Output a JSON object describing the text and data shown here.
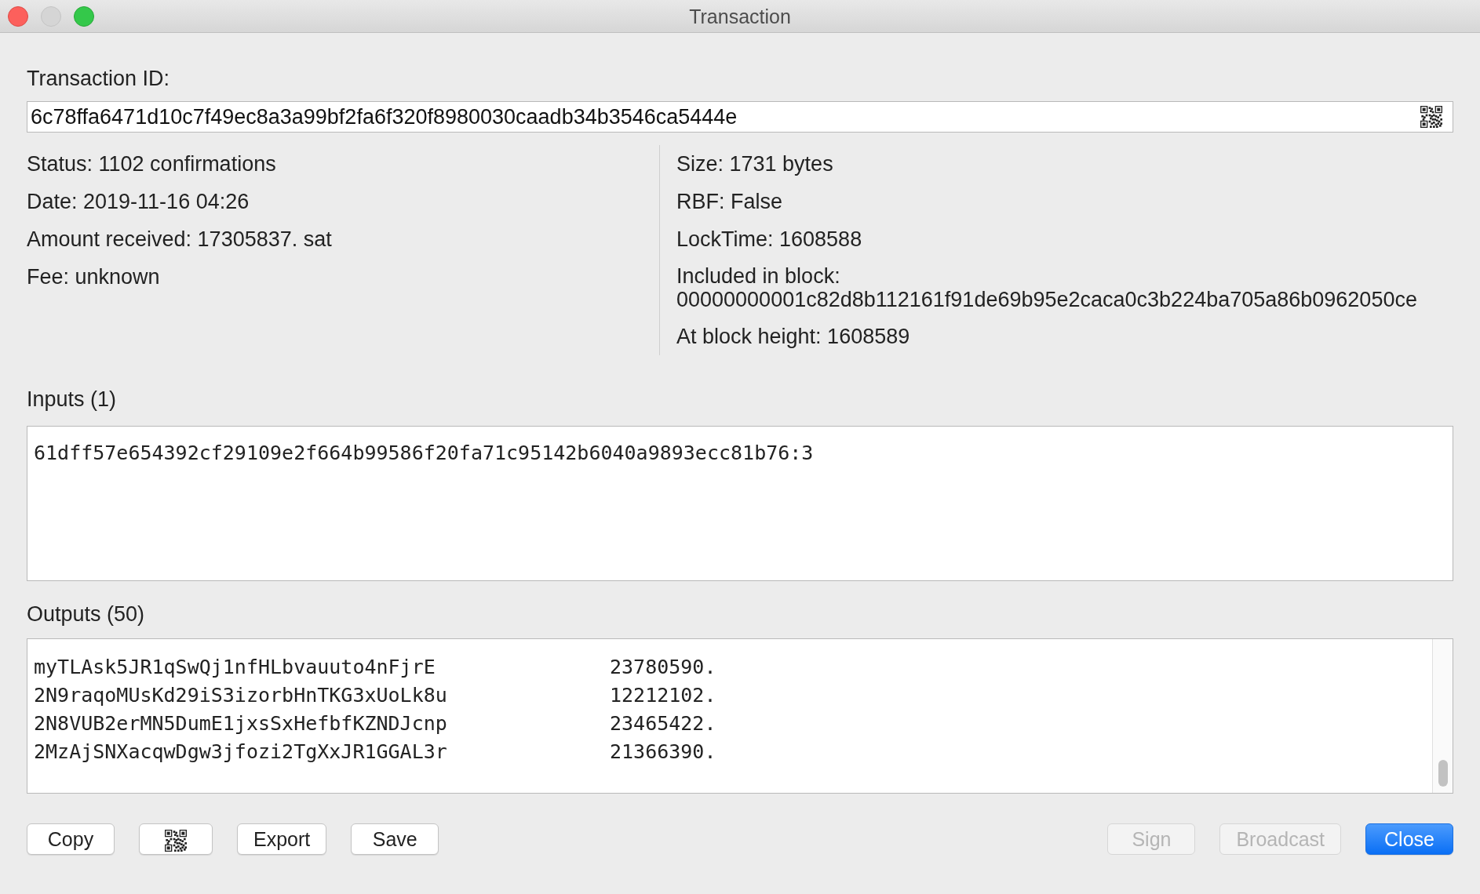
{
  "window": {
    "title": "Transaction"
  },
  "transaction_id": {
    "label": "Transaction ID:",
    "value": "6c78ffa6471d10c7f49ec8a3a99bf2fa6f320f8980030caadb34b3546ca5444e"
  },
  "details_left": [
    "Status: 1102 confirmations",
    "Date: 2019-11-16 04:26",
    "Amount received: 17305837. sat",
    "Fee: unknown"
  ],
  "details_right": [
    {
      "kind": "line",
      "text": "Size: 1731 bytes"
    },
    {
      "kind": "line",
      "text": "RBF: False"
    },
    {
      "kind": "line",
      "text": "LockTime: 1608588"
    },
    {
      "kind": "block",
      "text": "Included in block:",
      "value": "00000000001c82d8b112161f91de69b95e2caca0c3b224ba705a86b0962050ce"
    },
    {
      "kind": "line",
      "text": "At block height: 1608589"
    }
  ],
  "inputs": {
    "label": "Inputs (1)",
    "lines": [
      "61dff57e654392cf29109e2f664b99586f20fa71c95142b6040a9893ecc81b76:3"
    ]
  },
  "outputs": {
    "label": "Outputs (50)",
    "rows": [
      {
        "address": "myTLAsk5JR1qSwQj1nfHLbvauuto4nFjrE",
        "amount": "23780590."
      },
      {
        "address": "2N9raqoMUsKd29iS3izorbHnTKG3xUoLk8u",
        "amount": "12212102."
      },
      {
        "address": "2N8VUB2erMN5DumE1jxsSxHefbfKZNDJcnp",
        "amount": "23465422."
      },
      {
        "address": "2MzAjSNXacqwDgw3jfozi2TgXxJR1GGAL3r",
        "amount": "21366390."
      }
    ]
  },
  "buttons": [
    {
      "kind": "text",
      "label": "Copy",
      "disabled": false,
      "default": false
    },
    {
      "kind": "qr",
      "disabled": false,
      "default": false
    },
    {
      "kind": "text",
      "label": "Export",
      "disabled": false,
      "default": false
    },
    {
      "kind": "text",
      "label": "Save",
      "disabled": false,
      "default": false
    },
    {
      "kind": "spacer"
    },
    {
      "kind": "text",
      "label": "Sign",
      "disabled": true,
      "default": false
    },
    {
      "kind": "text",
      "label": "Broadcast",
      "disabled": true,
      "default": false
    },
    {
      "kind": "text",
      "label": "Close",
      "disabled": false,
      "default": true
    }
  ]
}
